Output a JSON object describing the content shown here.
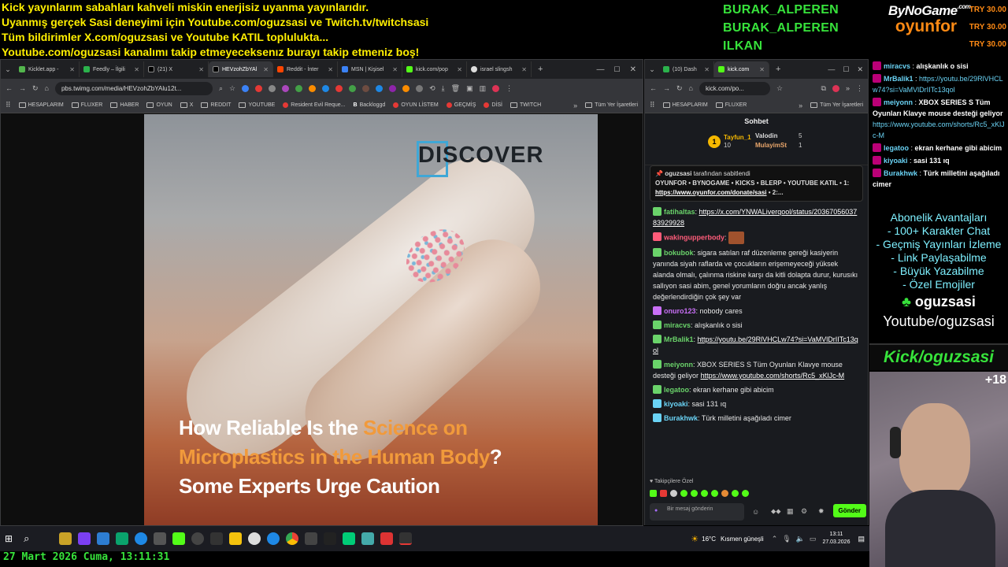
{
  "banner": {
    "lines": [
      "Kick yayınlarım sabahları kahveli miskin enerjisiz uyanma yayınlarıdır.",
      "Uyanmış gerçek Sasi deneyimi için Youtube.com/oguzsasi ve Twitch.tv/twitchsasi",
      "Tüm bildirimler X.com/oguzsasi ve Youtube KATIL topluluktа...",
      "Youtube.com/oguzsasi kanalımı takip etmeyeceksenız burayı takip etmeniz boş!"
    ]
  },
  "names": [
    "BURAK_ALPEREN",
    "BURAK_ALPEREN",
    "ILKAN"
  ],
  "brand": {
    "line1": "ByNoGame",
    "sup": ".com",
    "line2": "oyunfor"
  },
  "try": [
    "TRY 30.00",
    "TRY 30.00",
    "TRY 30.00"
  ],
  "browser": {
    "tabs": [
      "Kicklet.app -",
      "Feedly – İlgili",
      "(21) X",
      "HEVzohZbYAl",
      "Reddit - İnter",
      "MSN | Kişisel",
      "kick.com/pop",
      "israel slingsh"
    ],
    "url": "pbs.twimg.com/media/HEVzohZbYAlu12t...",
    "bookmarks": [
      "HESAPLARIM",
      "FLUXER",
      "HABER",
      "OYUN",
      "X",
      "REDDIT",
      "YOUTUBE",
      "Resident Evil Reque...",
      "Backloggd",
      "OYUN LİSTEM",
      "GEÇMİŞ",
      "DİSİ",
      "TWITCH"
    ],
    "all_bookmarks": "Tüm Yer İşaretleri"
  },
  "image": {
    "logo": "DISCOVER",
    "headline_1a": "How Reliable Is the ",
    "headline_1b": "Science on",
    "headline_2a": "Microplastics in the Human Body",
    "headline_2b": "?",
    "headline_3": "Some Experts Urge Caution"
  },
  "chatwin": {
    "tabs": [
      "(10) Dash",
      "kick.com"
    ],
    "url": "kick.com/po...",
    "bookmarks": [
      "HESAPLARIM",
      "FLUXER"
    ],
    "all_bookmarks": "Tüm Yer İşaretleri",
    "title": "Sohbet",
    "top1_name": "Tayfun_1",
    "top1_count": "10",
    "top2_name": "Valodin",
    "top2_count": "5",
    "top3_name": "MulayimSt",
    "top3_count": "1",
    "pinned_by_user": "oguzsasi",
    "pinned_by": "tarafından sabitlendi",
    "pinned_text": "OYUNFOR • BYNOGAME • KICKS • BLERP • YOUTUBE KATIL • 1:",
    "pinned_link": "https://www.oyunfor.com/donate/sasi",
    "pinned_suffix": "• 2:...",
    "messages": [
      {
        "user": "fatihaltas",
        "text": "",
        "link": "https://x.com/YNWALiverqool/status/2036705603783929928",
        "color": "#6ad36a"
      },
      {
        "user": "wakingupperbody",
        "text": "",
        "link": "",
        "color": "#ff5c7a"
      },
      {
        "user": "bokubok",
        "text": "sigara satılan raf düzenleme gereği kasiyerin yanında siyah raflarda ve çocukların erişemeyeceği yüksek alanda olmalı, çalınma riskine karşı da kitli dolapta durur, kurusıkı sallıyon sasi abim, genel yorumların doğru ancak yanlış değerlendirdiğin çok şey var",
        "link": "",
        "color": "#6ad36a"
      },
      {
        "user": "onuro123",
        "text": "nobody cares",
        "link": "",
        "color": "#c86ff5"
      },
      {
        "user": "miracvs",
        "text": "alışkanlık o sisi",
        "link": "",
        "color": "#6ad36a"
      },
      {
        "user": "MrBalik1",
        "text": "",
        "link": "https://youtu.be/29RlVHCLw74?si=VaMVlDrIITc13qol",
        "color": "#6ad36a"
      },
      {
        "user": "meiyonn",
        "text": "XBOX SERIES S Tüm Oyunları Klavye mouse desteği geliyor",
        "link": "https://www.youtube.com/shorts/Rc5_xKlJc-M",
        "color": "#6ad36a"
      },
      {
        "user": "legatoo",
        "text": "ekran kerhane gibi abicim",
        "link": "",
        "color": "#6ad36a"
      },
      {
        "user": "kiyoaki",
        "text": "sasi 131 ıq",
        "link": "",
        "color": "#6ad3f5"
      },
      {
        "user": "Burakhwk",
        "text": "Türk milletini aşağıladı cimer",
        "link": "",
        "color": "#6ad3f5"
      }
    ],
    "favs_label": "Takipçilere Özel",
    "input_placeholder": "Bir mesaj gönderin",
    "send": "Gönder"
  },
  "rightchat": [
    {
      "user": "miracvs",
      "text": "alışkanlık o sisi",
      "link": ""
    },
    {
      "user": "MrBalik1",
      "text": "",
      "link": "https://youtu.be/29RlVHCLw74?si=VaMVlDrIITc13qol"
    },
    {
      "user": "meiyonn",
      "text": "XBOX SERIES S Tüm Oyunları Klavye mouse desteği geliyor",
      "link": "https://www.youtube.com/shorts/Rc5_xKlJc-M"
    },
    {
      "user": "legatoo",
      "text": "ekran kerhane gibi abicim",
      "link": ""
    },
    {
      "user": "kiyoaki",
      "text": "sasi 131 ıq",
      "link": ""
    },
    {
      "user": "Burakhwk",
      "text": "Türk milletini aşağıladı cimer",
      "link": ""
    }
  ],
  "perks": [
    "Abonelik Avantajları",
    "- 100+ Karakter Chat",
    "- Geçmiş Yayınları İzleme",
    "- Link Paylaşabilme",
    "- Büyük Yazabilme",
    "- Özel Emojiler"
  ],
  "owner": {
    "name": "oguzsasi",
    "youtube": "Youtube/oguzsasi",
    "kick": "Kick/oguzsasi"
  },
  "webcam_badge": "+18",
  "taskbar": {
    "weather": "16°C",
    "weather_text": "Kısmen güneşli",
    "time": "13:11",
    "date": "27.03.2026"
  },
  "bottom_date": "27 Mart 2026 Cuma, 13:11:31"
}
